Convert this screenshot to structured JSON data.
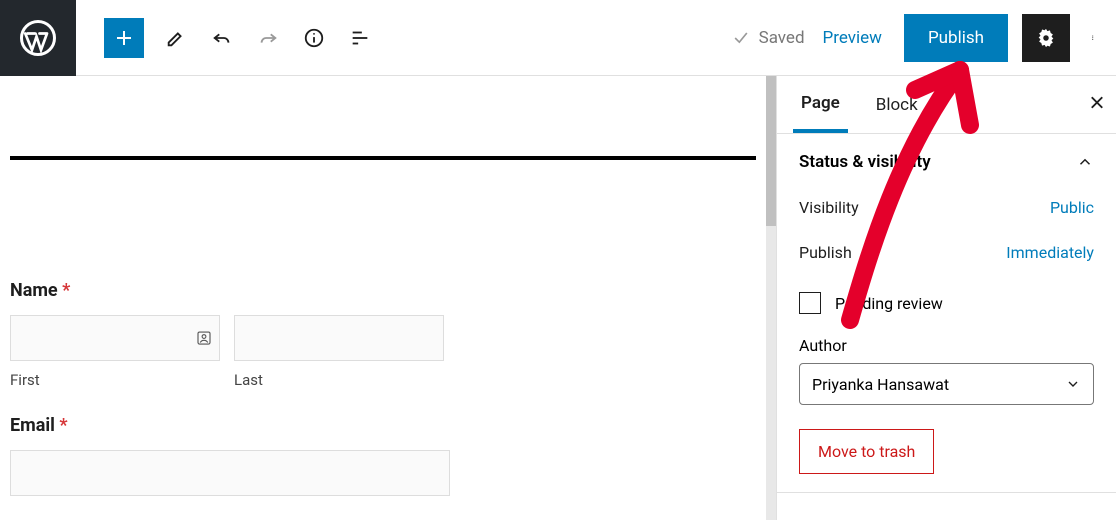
{
  "topbar": {
    "saved_label": "Saved",
    "preview_label": "Preview",
    "publish_label": "Publish"
  },
  "editor": {
    "name_label": "Name",
    "first_sub": "First",
    "last_sub": "Last",
    "email_label": "Email",
    "required_mark": "*"
  },
  "sidebar": {
    "tabs": {
      "page": "Page",
      "block": "Block"
    },
    "status_visibility_heading": "Status & visibility",
    "visibility_label": "Visibility",
    "visibility_value": "Public",
    "publish_label": "Publish",
    "publish_value": "Immediately",
    "pending_review_label": "Pending review",
    "author_label": "Author",
    "author_value": "Priyanka Hansawat",
    "trash_label": "Move to trash"
  }
}
